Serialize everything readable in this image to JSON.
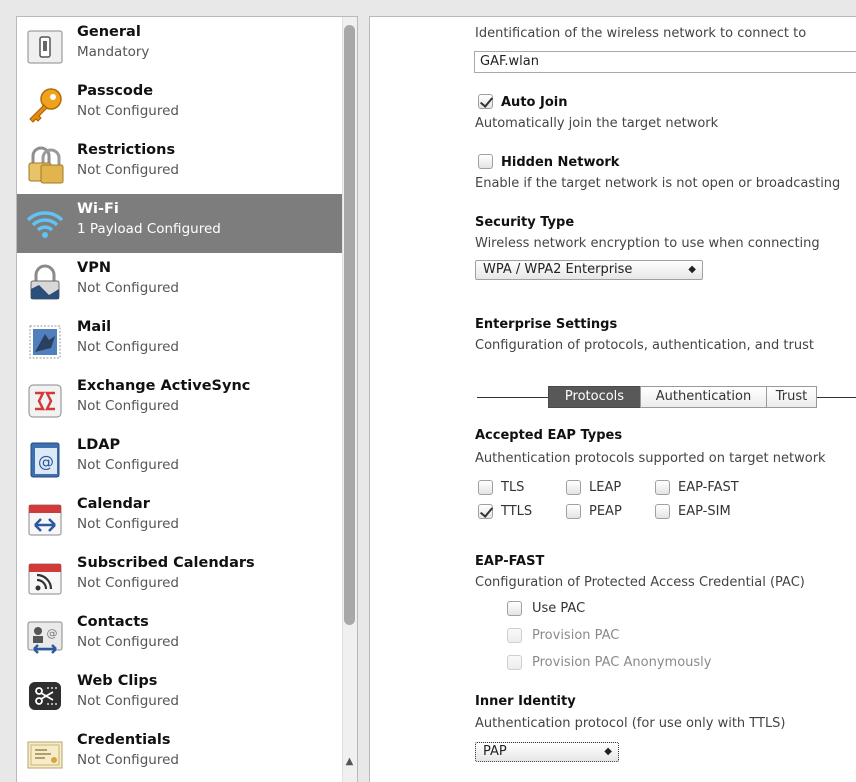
{
  "sidebar": {
    "items": [
      {
        "title": "General",
        "subtitle": "Mandatory",
        "icon": "general-icon"
      },
      {
        "title": "Passcode",
        "subtitle": "Not Configured",
        "icon": "key-icon"
      },
      {
        "title": "Restrictions",
        "subtitle": "Not Configured",
        "icon": "padlock-icon"
      },
      {
        "title": "Wi-Fi",
        "subtitle": "1 Payload Configured",
        "icon": "wifi-icon",
        "selected": true
      },
      {
        "title": "VPN",
        "subtitle": "Not Configured",
        "icon": "vpn-lock-icon"
      },
      {
        "title": "Mail",
        "subtitle": "Not Configured",
        "icon": "mail-stamp-icon"
      },
      {
        "title": "Exchange ActiveSync",
        "subtitle": "Not Configured",
        "icon": "exchange-icon"
      },
      {
        "title": "LDAP",
        "subtitle": "Not Configured",
        "icon": "ldap-at-icon"
      },
      {
        "title": "Calendar",
        "subtitle": "Not Configured",
        "icon": "calendar-icon"
      },
      {
        "title": "Subscribed Calendars",
        "subtitle": "Not Configured",
        "icon": "subscribed-calendar-icon"
      },
      {
        "title": "Contacts",
        "subtitle": "Not Configured",
        "icon": "contacts-icon"
      },
      {
        "title": "Web Clips",
        "subtitle": "Not Configured",
        "icon": "web-clips-icon"
      },
      {
        "title": "Credentials",
        "subtitle": "Not Configured",
        "icon": "certificate-icon"
      }
    ]
  },
  "wifi": {
    "ssid_description": "Identification of the wireless network to connect to",
    "ssid_value": "GAF.wlan",
    "auto_join_label": "Auto Join",
    "auto_join_checked": true,
    "auto_join_description": "Automatically join the target network",
    "hidden_network_label": "Hidden Network",
    "hidden_network_checked": false,
    "hidden_network_description": "Enable if the target network is not open or broadcasting",
    "security_type_label": "Security Type",
    "security_type_description": "Wireless network encryption to use when connecting",
    "security_type_value": "WPA / WPA2 Enterprise",
    "enterprise_label": "Enterprise Settings",
    "enterprise_description": "Configuration of protocols, authentication, and trust",
    "tabs": [
      "Protocols",
      "Authentication",
      "Trust"
    ],
    "active_tab": "Protocols",
    "eap_label": "Accepted EAP Types",
    "eap_description": "Authentication protocols supported on target network",
    "eap_types": [
      {
        "label": "TLS",
        "checked": false
      },
      {
        "label": "LEAP",
        "checked": false
      },
      {
        "label": "EAP-FAST",
        "checked": false
      },
      {
        "label": "TTLS",
        "checked": true
      },
      {
        "label": "PEAP",
        "checked": false
      },
      {
        "label": "EAP-SIM",
        "checked": false
      }
    ],
    "eap_fast_label": "EAP-FAST",
    "eap_fast_description": "Configuration of Protected Access Credential (PAC)",
    "use_pac_label": "Use PAC",
    "provision_pac_label": "Provision PAC",
    "provision_pac_anon_label": "Provision PAC Anonymously",
    "inner_identity_label": "Inner Identity",
    "inner_identity_description": "Authentication protocol (for use only with TTLS)",
    "inner_identity_value": "PAP"
  },
  "colors": {
    "selected_row": "#7d7d7d",
    "active_tab": "#585858"
  }
}
